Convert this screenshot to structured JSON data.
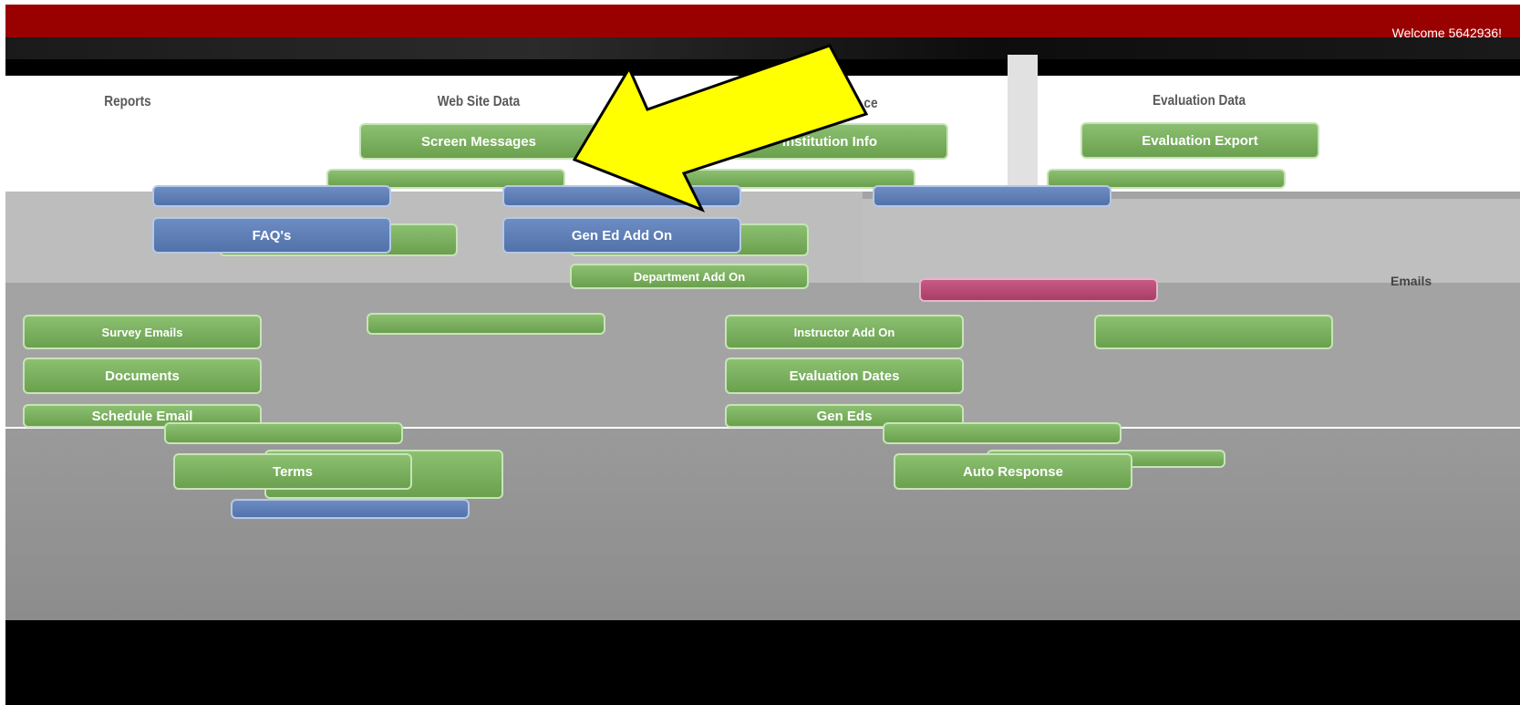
{
  "header": {
    "welcome_text": "Welcome 5642936!"
  },
  "columns": {
    "reports": "Reports",
    "web_site_data": "Web Site Data",
    "institution": "ce",
    "evaluation_data": "Evaluation Data"
  },
  "buttons": {
    "screen_messages": "Screen Messages",
    "institution_info": "Institution Info",
    "evaluation_export": "Evaluation Export",
    "faqs": "FAQ's",
    "gen_ed_add_on": "Gen Ed Add On",
    "department_add_on": "Department Add On",
    "instructor_add_on": "Instructor Add On",
    "documents": "Documents",
    "evaluation_dates": "Evaluation Dates",
    "schedule_email": "Schedule Email",
    "gen_eds": "Gen Eds",
    "terms": "Terms",
    "auto_response": "Auto Response",
    "survey_emails": "Survey Emails",
    "emails": "Emails"
  },
  "annotation": {
    "arrow_color": "#ffff00"
  },
  "colors": {
    "header": "#990000",
    "green": "#6aa04e",
    "blue": "#5272aa"
  }
}
